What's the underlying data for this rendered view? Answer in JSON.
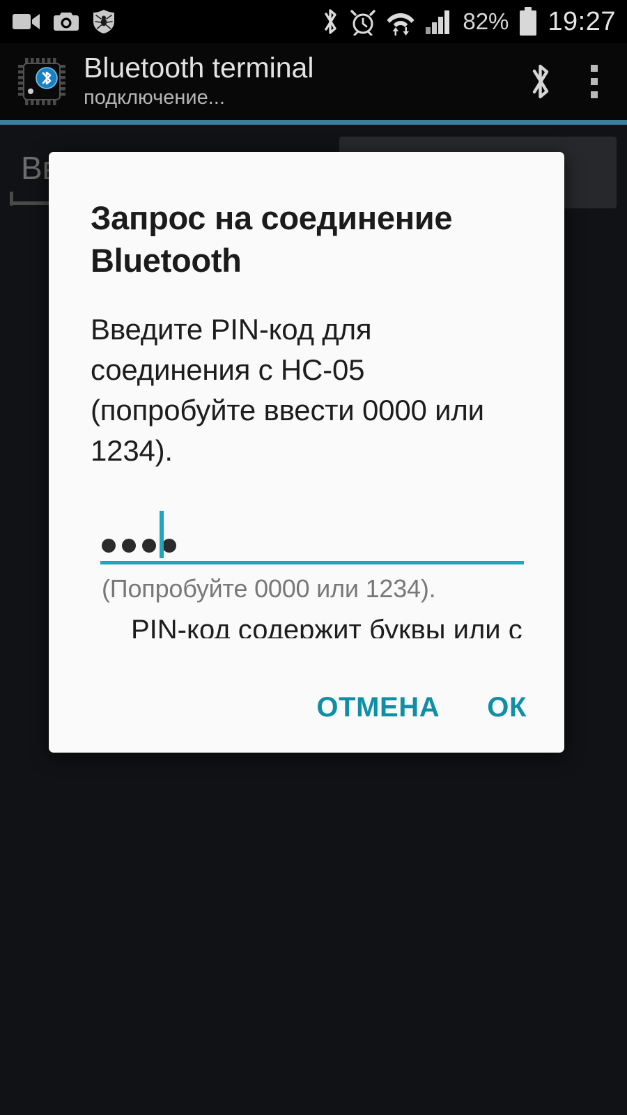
{
  "status_bar": {
    "icons_left": [
      "video-camera-icon",
      "camera-icon",
      "antivirus-shield-icon"
    ],
    "icons_right": [
      "bluetooth-icon",
      "alarm-clock-icon",
      "wifi-icon",
      "signal-bars-icon",
      "battery-icon"
    ],
    "battery_percent": "82%",
    "clock": "19:27"
  },
  "app_bar": {
    "icon": "bluetooth-chip-icon",
    "title": "Bluetooth terminal",
    "subtitle": "подключение...",
    "action_icon": "bluetooth-icon",
    "overflow_icon": "overflow-menu-icon",
    "accent_color": "#3c7e9c"
  },
  "background": {
    "field_label": "Вв",
    "panel": "dark-panel"
  },
  "dialog": {
    "title": "Запрос на соединение Bluetooth",
    "message": "Введите PIN-код для соединения с HC-05 (попробуйте ввести 0000 или 1234).",
    "pin_value": "••••",
    "pin_dots": 4,
    "helper_text": "(Попробуйте 0000 или 1234).",
    "clipped_text": "PIN-код содержит буквы или символы",
    "cancel_label": "ОТМЕНА",
    "ok_label": "ОК",
    "accent_color": "#0f8fa5",
    "underline_color": "#1fa6bd"
  }
}
